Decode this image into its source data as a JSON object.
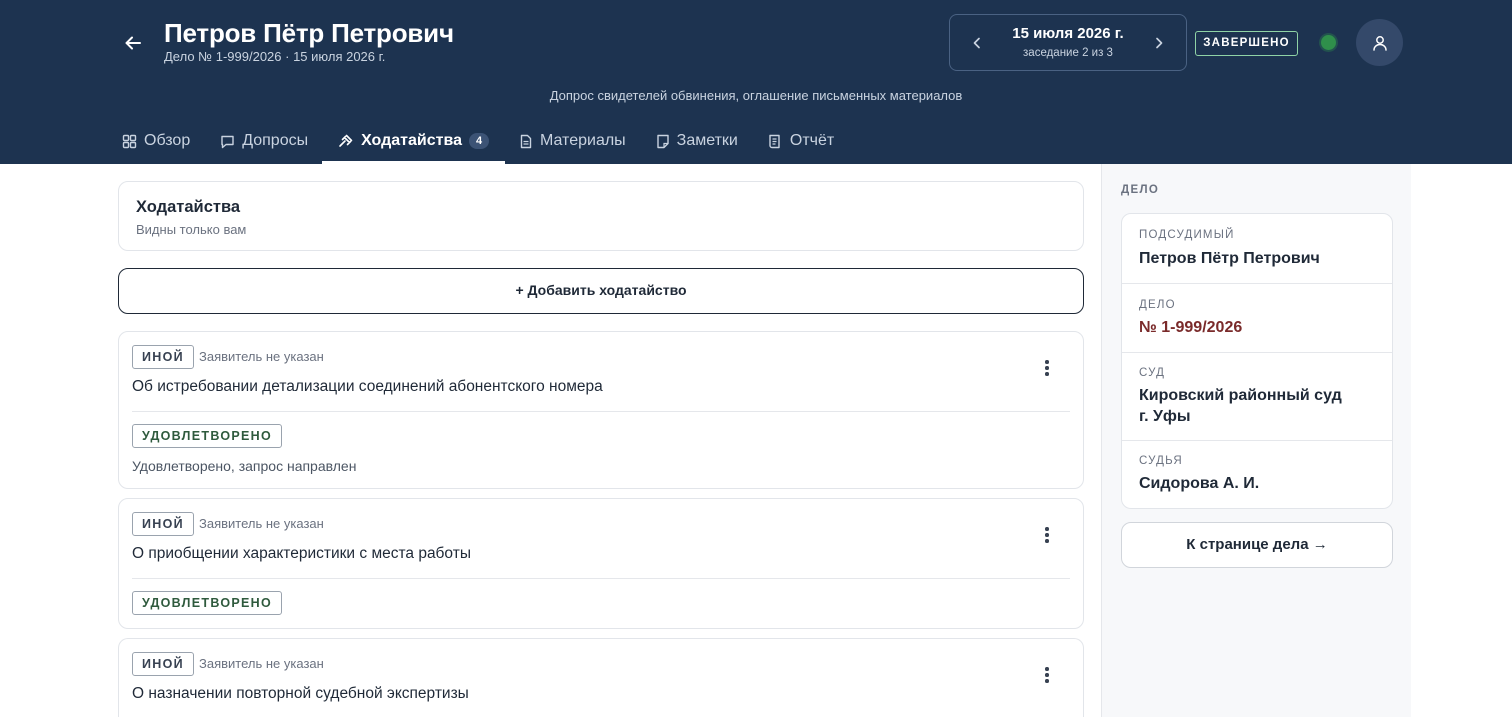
{
  "header": {
    "title": "Петров Пётр Петрович",
    "subtitle": "Дело № 1-999/2026 · 15 июля 2026 г.",
    "session_date": "15 июля 2026 г.",
    "session_count": "заседание 2 из 3",
    "status": "ЗАВЕРШЕНО",
    "session_description": "Допрос свидетелей обвинения, оглашение письменных материалов"
  },
  "tabs": [
    {
      "label": "Обзор",
      "icon": "grid-icon"
    },
    {
      "label": "Допросы",
      "icon": "chat-icon"
    },
    {
      "label": "Ходатайства",
      "icon": "gavel-icon",
      "count": "4",
      "active": true
    },
    {
      "label": "Материалы",
      "icon": "document-icon"
    },
    {
      "label": "Заметки",
      "icon": "note-icon"
    },
    {
      "label": "Отчёт",
      "icon": "report-icon"
    }
  ],
  "section": {
    "title": "Ходатайства",
    "subtitle": "Видны только вам",
    "add_label": "+ Добавить ходатайство"
  },
  "motions": [
    {
      "type": "ИНОЙ",
      "applicant": "Заявитель не указан",
      "title": "Об истребовании детализации соединений абонентского номера",
      "result": "УДОВЛЕТВОРЕНО",
      "note": "Удовлетворено, запрос направлен"
    },
    {
      "type": "ИНОЙ",
      "applicant": "Заявитель не указан",
      "title": "О приобщении характеристики с места работы",
      "result": "УДОВЛЕТВОРЕНО",
      "note": ""
    },
    {
      "type": "ИНОЙ",
      "applicant": "Заявитель не указан",
      "title": "О назначении повторной судебной экспертизы",
      "result": "",
      "note": ""
    }
  ],
  "sidebar": {
    "heading": "ДЕЛО",
    "defendant_label": "ПОДСУДИМЫЙ",
    "defendant": "Петров Пётр Петрович",
    "case_label": "ДЕЛО",
    "case_number": "№ 1-999/2026",
    "court_label": "СУД",
    "court_line1": "Кировский районный суд",
    "court_line2": "г. Уфы",
    "judge_label": "СУДЬЯ",
    "judge": "Сидорова А. И.",
    "case_page_button": "К странице дела →"
  },
  "colors": {
    "header_bg": "#1d3350",
    "status_dot": "#2f8f4b",
    "case_number": "#7a2a2a"
  }
}
